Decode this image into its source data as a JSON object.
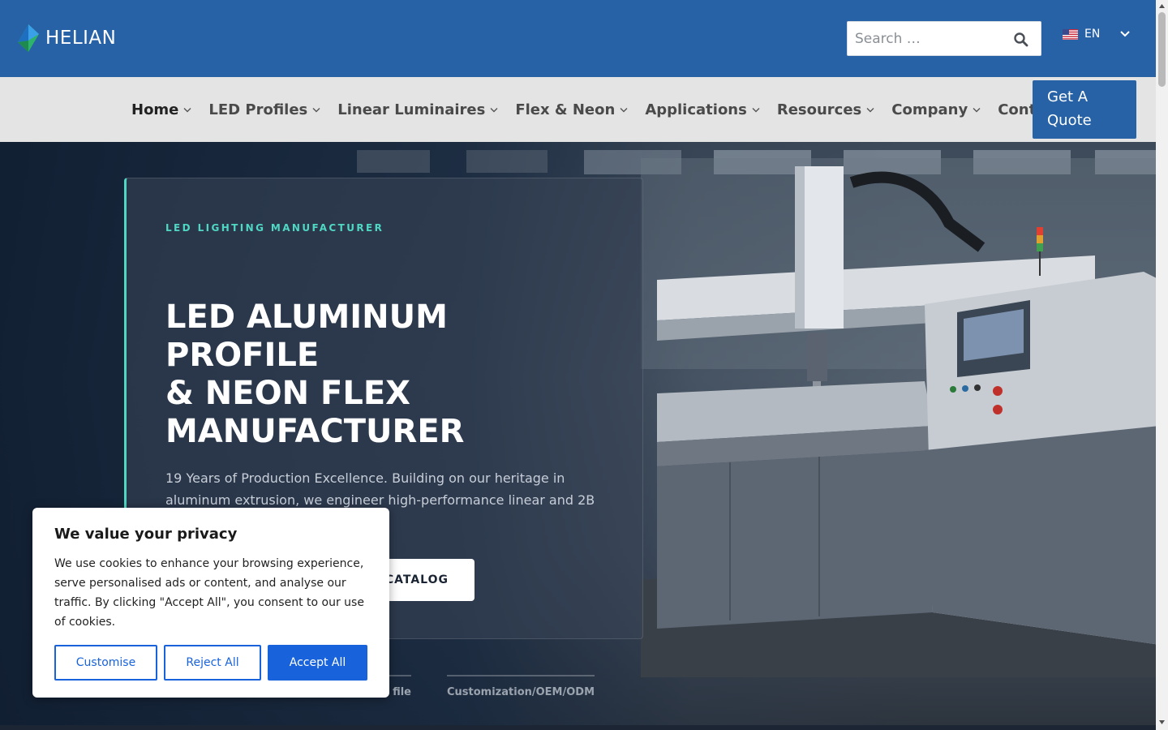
{
  "brand": {
    "name": "HELIAN"
  },
  "search": {
    "placeholder": "Search …"
  },
  "language": {
    "code": "EN"
  },
  "nav": {
    "items": [
      {
        "label": "Home",
        "dropdown": true,
        "active": true
      },
      {
        "label": "LED Profiles",
        "dropdown": true
      },
      {
        "label": "Linear Luminaires",
        "dropdown": true
      },
      {
        "label": "Flex & Neon",
        "dropdown": true
      },
      {
        "label": "Applications",
        "dropdown": true
      },
      {
        "label": "Resources",
        "dropdown": true
      },
      {
        "label": "Company",
        "dropdown": true
      },
      {
        "label": "Contact",
        "dropdown": false
      }
    ],
    "quote_button": "Get A Quote"
  },
  "hero": {
    "eyebrow": "LED LIGHTING MANUFACTURER",
    "title_lines": [
      "LED ALUMINUM",
      "PROFILE",
      "& NEON FLEX",
      "MANUFACTURER"
    ],
    "description": "19 Years of Production Excellence. Building on our heritage in aluminum extrusion, we engineer high-performance linear and 2B partners.",
    "catalog_button": "CATALOG",
    "tabs": [
      "file",
      "Customization/OEM/ODM"
    ]
  },
  "cookie": {
    "title": "We value your privacy",
    "text": "We use cookies to enhance your browsing experience, serve personalised ads or content, and analyse our traffic. By clicking \"Accept All\", you consent to our use of cookies.",
    "customise": "Customise",
    "reject": "Reject All",
    "accept": "Accept All"
  },
  "colors": {
    "header_blue": "#2762a6",
    "accent_teal": "#4fd7c4",
    "cookie_blue": "#1863dc"
  }
}
